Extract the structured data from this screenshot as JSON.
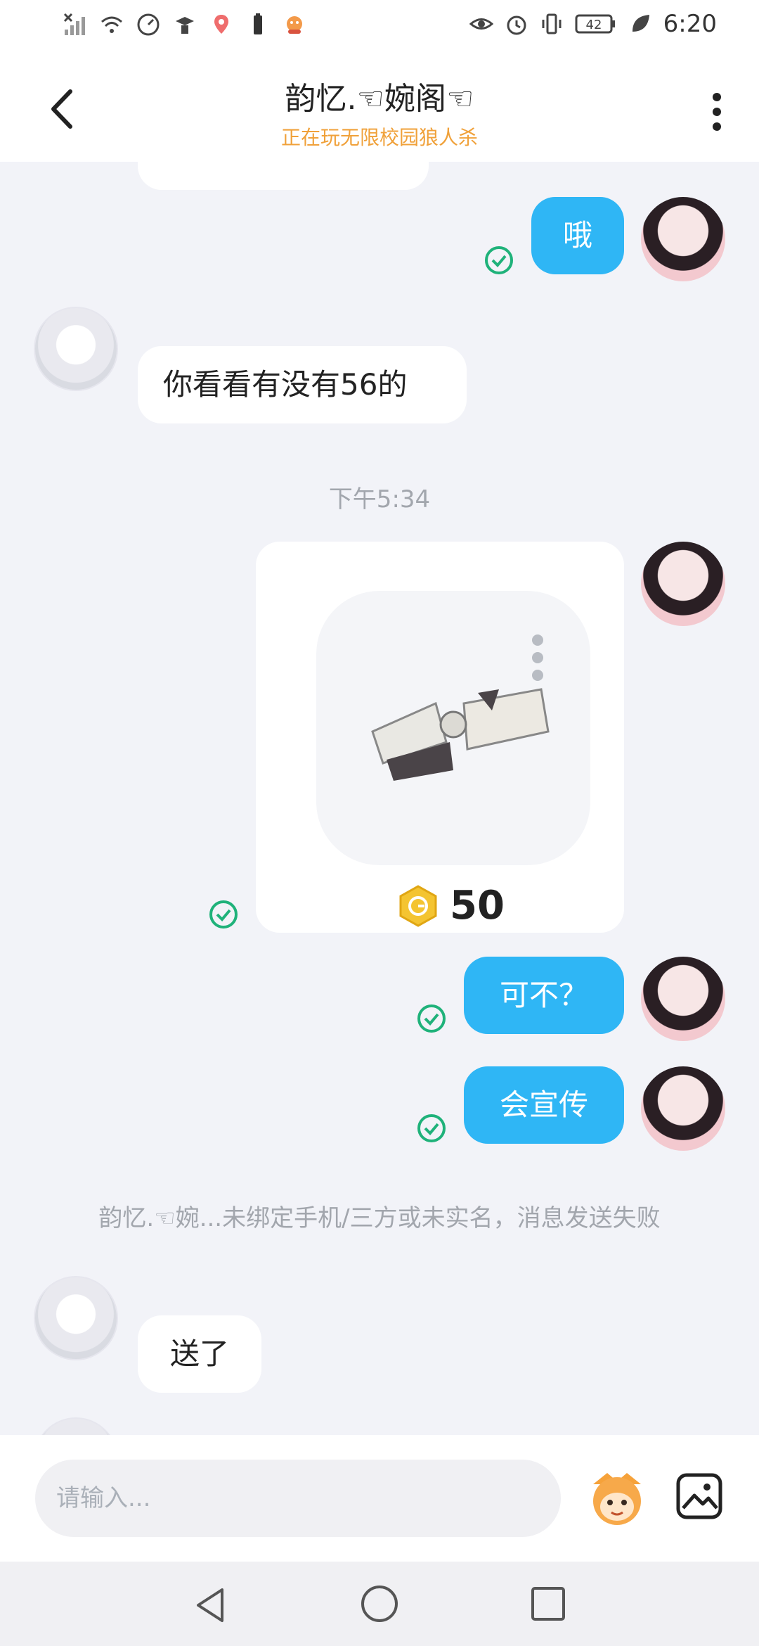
{
  "status_bar": {
    "time": "6:20",
    "battery": "42",
    "icons": [
      "no-signal-icon",
      "wifi-icon",
      "speed-icon",
      "hat-icon",
      "map-pin-icon",
      "battery-saver-icon",
      "game-icon",
      "eye-icon",
      "alarm-icon",
      "vibrate-icon",
      "battery-icon",
      "leaf-icon"
    ]
  },
  "header": {
    "title": "韵忆.☜婉阁☜",
    "subtitle": "正在玩无限校园狼人杀"
  },
  "messages": {
    "m1": "哦",
    "m2": "你看看有没有56的",
    "time1": "下午5:34",
    "gift_price": "50",
    "m3": "可不？",
    "m4": "会宣传",
    "notice": "韵忆.☜婉...未绑定手机/三方或未实名，消息发送失败",
    "m5": "送了"
  },
  "input": {
    "placeholder": "请输入..."
  },
  "colors": {
    "outgoing_bubble": "#2fb6f5",
    "incoming_bubble": "#ffffff",
    "subtitle": "#f0a13a",
    "check": "#1fb27a",
    "background": "#f2f3f8"
  }
}
